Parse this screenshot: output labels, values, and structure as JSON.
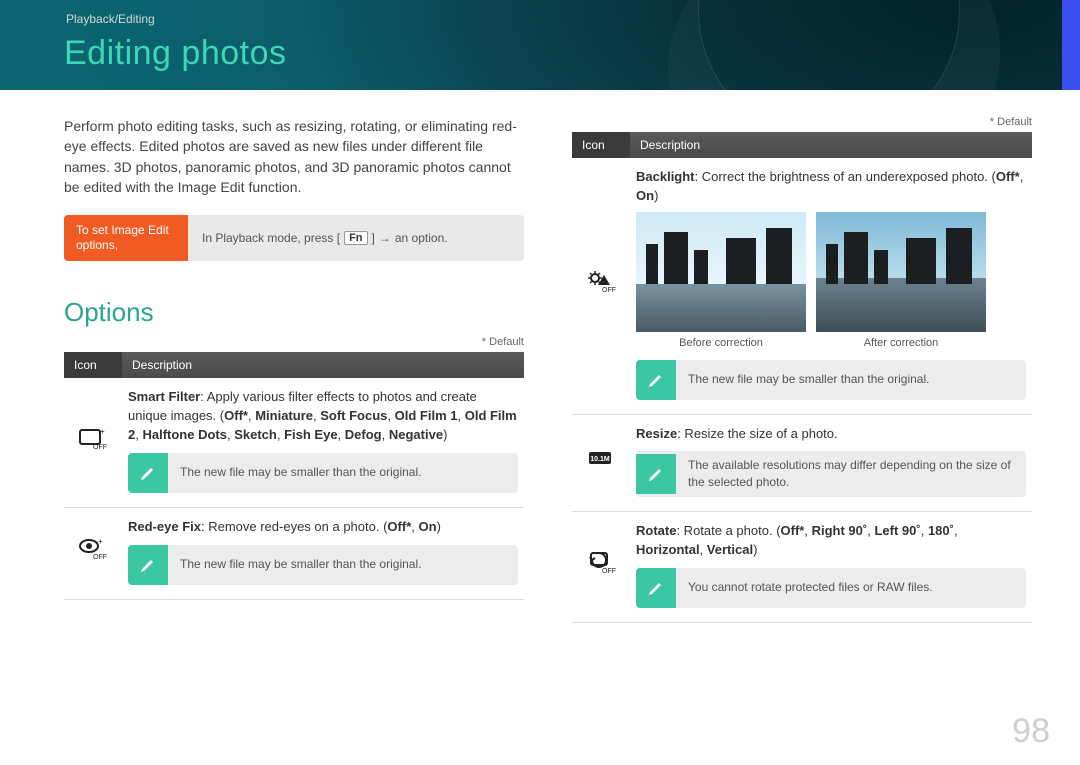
{
  "breadcrumb": "Playback/Editing",
  "title": "Editing photos",
  "intro": "Perform photo editing tasks, such as resizing, rotating, or eliminating red-eye effects. Edited photos are saved as new files under different file names. 3D photos, panoramic photos, and 3D panoramic photos cannot be edited with the Image Edit function.",
  "instr": {
    "left": "To set Image Edit options,",
    "right_pre": "In Playback mode, press [",
    "fn": "Fn",
    "right_post": "an option."
  },
  "options_heading": "Options",
  "default_note": "* Default",
  "headers": {
    "icon": "Icon",
    "desc": "Description"
  },
  "left_rows": [
    {
      "icon": "smart-filter-icon",
      "desc_html": "<b>Smart Filter</b>: Apply various filter effects to photos and create unique images. (<b>Off*</b>, <b>Miniature</b>, <b>Soft Focus</b>, <b>Old Film 1</b>, <b>Old Film 2</b>, <b>Halftone Dots</b>, <b>Sketch</b>, <b>Fish Eye</b>, <b>Defog</b>, <b>Negative</b>)",
      "note": "The new file may be smaller than the original."
    },
    {
      "icon": "redeye-icon",
      "desc_html": "<b>Red-eye Fix</b>: Remove red-eyes on a photo. (<b>Off*</b>, <b>On</b>)",
      "note": "The new file may be smaller than the original."
    }
  ],
  "right_rows": [
    {
      "icon": "backlight-icon",
      "desc_html": "<b>Backlight</b>: Correct the brightness of an underexposed photo. (<b>Off*</b>, <b>On</b>)",
      "images": {
        "before": "Before correction",
        "after": "After correction"
      },
      "note": "The new file may be smaller than the original."
    },
    {
      "icon": "resize-icon",
      "desc_html": "<b>Resize</b>: Resize the size of a photo.",
      "note": "The available resolutions may differ depending on the size of the selected photo."
    },
    {
      "icon": "rotate-icon",
      "desc_html": "<b>Rotate</b>: Rotate a photo. (<b>Off*</b>, <b>Right 90˚</b>, <b>Left 90˚</b>, <b>180˚</b>, <b>Horizontal</b>, <b>Vertical</b>)",
      "note": "You cannot rotate protected files or RAW files."
    }
  ],
  "page_number": "98"
}
